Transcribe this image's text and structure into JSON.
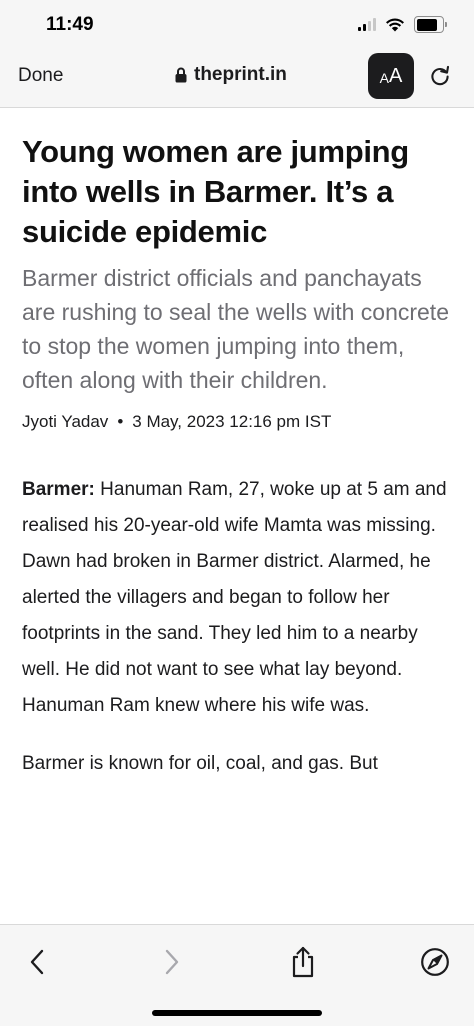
{
  "status_bar": {
    "time": "11:49",
    "signal_icon": "cellular-signal-icon",
    "wifi_icon": "wifi-icon",
    "battery_icon": "battery-icon"
  },
  "nav": {
    "done_label": "Done",
    "lock_icon": "lock-icon",
    "url": "theprint.in",
    "reader_button_label_small": "A",
    "reader_button_label_large": "A",
    "reload_icon": "reload-icon"
  },
  "article": {
    "headline": "Young women are jumping into wells in Barmer. It’s a suicide epidemic",
    "subhead": "Barmer district officials and panchayats are rushing to seal the wells with concrete to stop the women jumping into them, often along with their children.",
    "author": "Jyoti Yadav",
    "separator": "•",
    "date": "3 May, 2023 12:16 pm IST",
    "paragraph1_lead": "Barmer:",
    "paragraph1_text": " Hanuman Ram, 27, woke up at 5 am and realised his 20-year-old wife Mamta was missing. Dawn had broken in Barmer district. Alarmed, he alerted the villagers and began to follow her footprints in the sand. They led him to a nearby well. He did not want to see what lay beyond. Hanuman Ram knew where his wife was.",
    "paragraph2_text": "Barmer is known for oil, coal, and gas. But"
  },
  "toolbar": {
    "back_icon": "back-chevron-icon",
    "forward_icon": "forward-chevron-icon",
    "share_icon": "share-icon",
    "compass_icon": "compass-icon"
  },
  "colors": {
    "bar_background": "#f6f6f6",
    "subhead_gray": "#6e6e73",
    "text": "#1c1c1e",
    "disabled": "#a8a8ad"
  }
}
